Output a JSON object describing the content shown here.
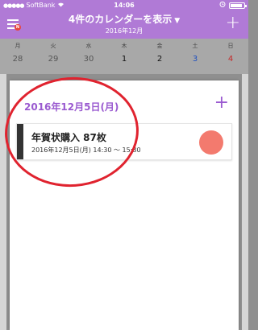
{
  "status_bar": {
    "carrier": "SoftBank",
    "time": "14:06",
    "battery_level": 0.9
  },
  "header": {
    "title": "4件のカレンダーを表示",
    "title_caret": "▼",
    "subtitle": "2016年12月",
    "menu_badge": "N",
    "add_label": "+"
  },
  "week": {
    "days": [
      {
        "dow": "月",
        "date": "28",
        "style": "past"
      },
      {
        "dow": "火",
        "date": "29",
        "style": "past"
      },
      {
        "dow": "水",
        "date": "30",
        "style": "past"
      },
      {
        "dow": "木",
        "date": "1",
        "style": "cur"
      },
      {
        "dow": "金",
        "date": "2",
        "style": "cur"
      },
      {
        "dow": "土",
        "date": "3",
        "style": "sat"
      },
      {
        "dow": "日",
        "date": "4",
        "style": "sun"
      }
    ]
  },
  "panel": {
    "date_label": "2016年12月5日(月)",
    "add_label": "+",
    "event": {
      "title": "年賀状購入 87枚",
      "time": "2016年12月5日(月) 14:30 〜 15:30",
      "color": "#f37a6e",
      "bar_color": "#333333"
    }
  },
  "annotation_color": "#e0232f"
}
